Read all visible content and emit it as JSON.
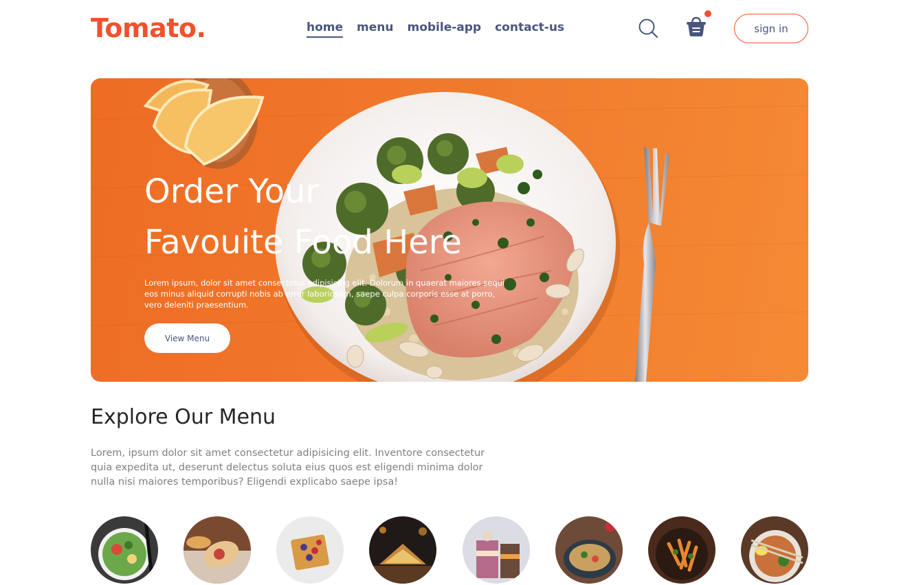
{
  "brand": {
    "logo": "Tomato.",
    "accent": "#f0522e",
    "nav_color": "#49557e"
  },
  "nav": {
    "links": [
      {
        "label": "home",
        "active": true
      },
      {
        "label": "menu",
        "active": false
      },
      {
        "label": "mobile-app",
        "active": false
      },
      {
        "label": "contact-us",
        "active": false
      }
    ],
    "search_icon": "search-icon",
    "basket_icon": "basket-icon",
    "signin_label": "sign in"
  },
  "hero": {
    "title_line1": "Order Your",
    "title_line2": "Favouite Food Here",
    "description": "Lorem ipsum, dolor sit amet consectetur adipisicing elit. Dolorum in quaerat maiores sequi eos minus aliquid corrupti nobis ab error laboriosam, saepe culpa corporis esse at porro, vero deleniti praesentium.",
    "button_label": "View Menu"
  },
  "explore": {
    "title": "Explore Our Menu",
    "text": "Lorem, ipsum dolor sit amet consectetur adipisicing elit. Inventore consectetur quia expedita ut, deserunt delectus soluta eius quos est eligendi minima dolor nulla nisi maiores temporibus? Eligendi explicabo saepe ipsa!"
  },
  "menu_items": [
    {
      "icon": "salad-icon"
    },
    {
      "icon": "rolls-icon"
    },
    {
      "icon": "deserts-icon"
    },
    {
      "icon": "sandwich-icon"
    },
    {
      "icon": "cake-icon"
    },
    {
      "icon": "pure-veg-icon"
    },
    {
      "icon": "pasta-icon"
    },
    {
      "icon": "noodles-icon"
    }
  ]
}
